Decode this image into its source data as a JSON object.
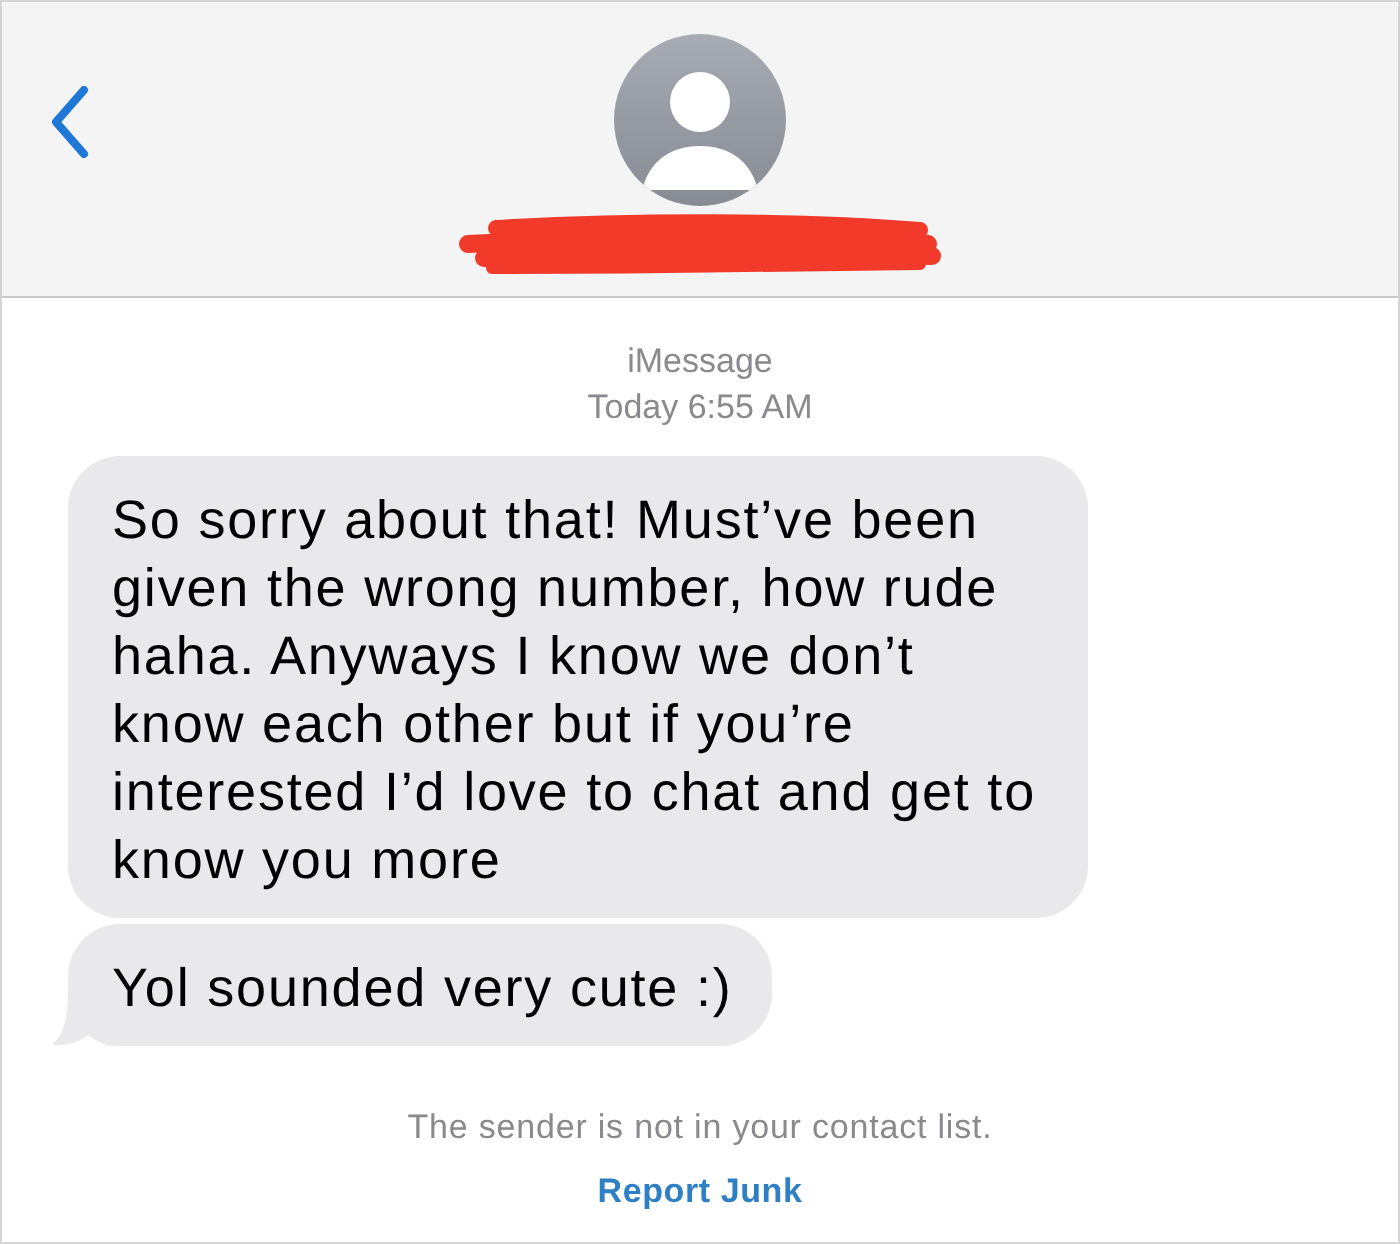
{
  "thread": {
    "service": "iMessage",
    "timestamp": "Today 6:55 AM",
    "messages": [
      {
        "text": "So sorry about that! Must’ve been given the wrong number, how rude haha. Anyways I know we don’t know each other but if you’re interested I’d love to chat and get to know you more",
        "tail": false
      },
      {
        "text": "Yol sounded very cute :)",
        "tail": true
      }
    ]
  },
  "notice": {
    "text": "The sender is not in your contact list.",
    "action": "Report Junk"
  }
}
